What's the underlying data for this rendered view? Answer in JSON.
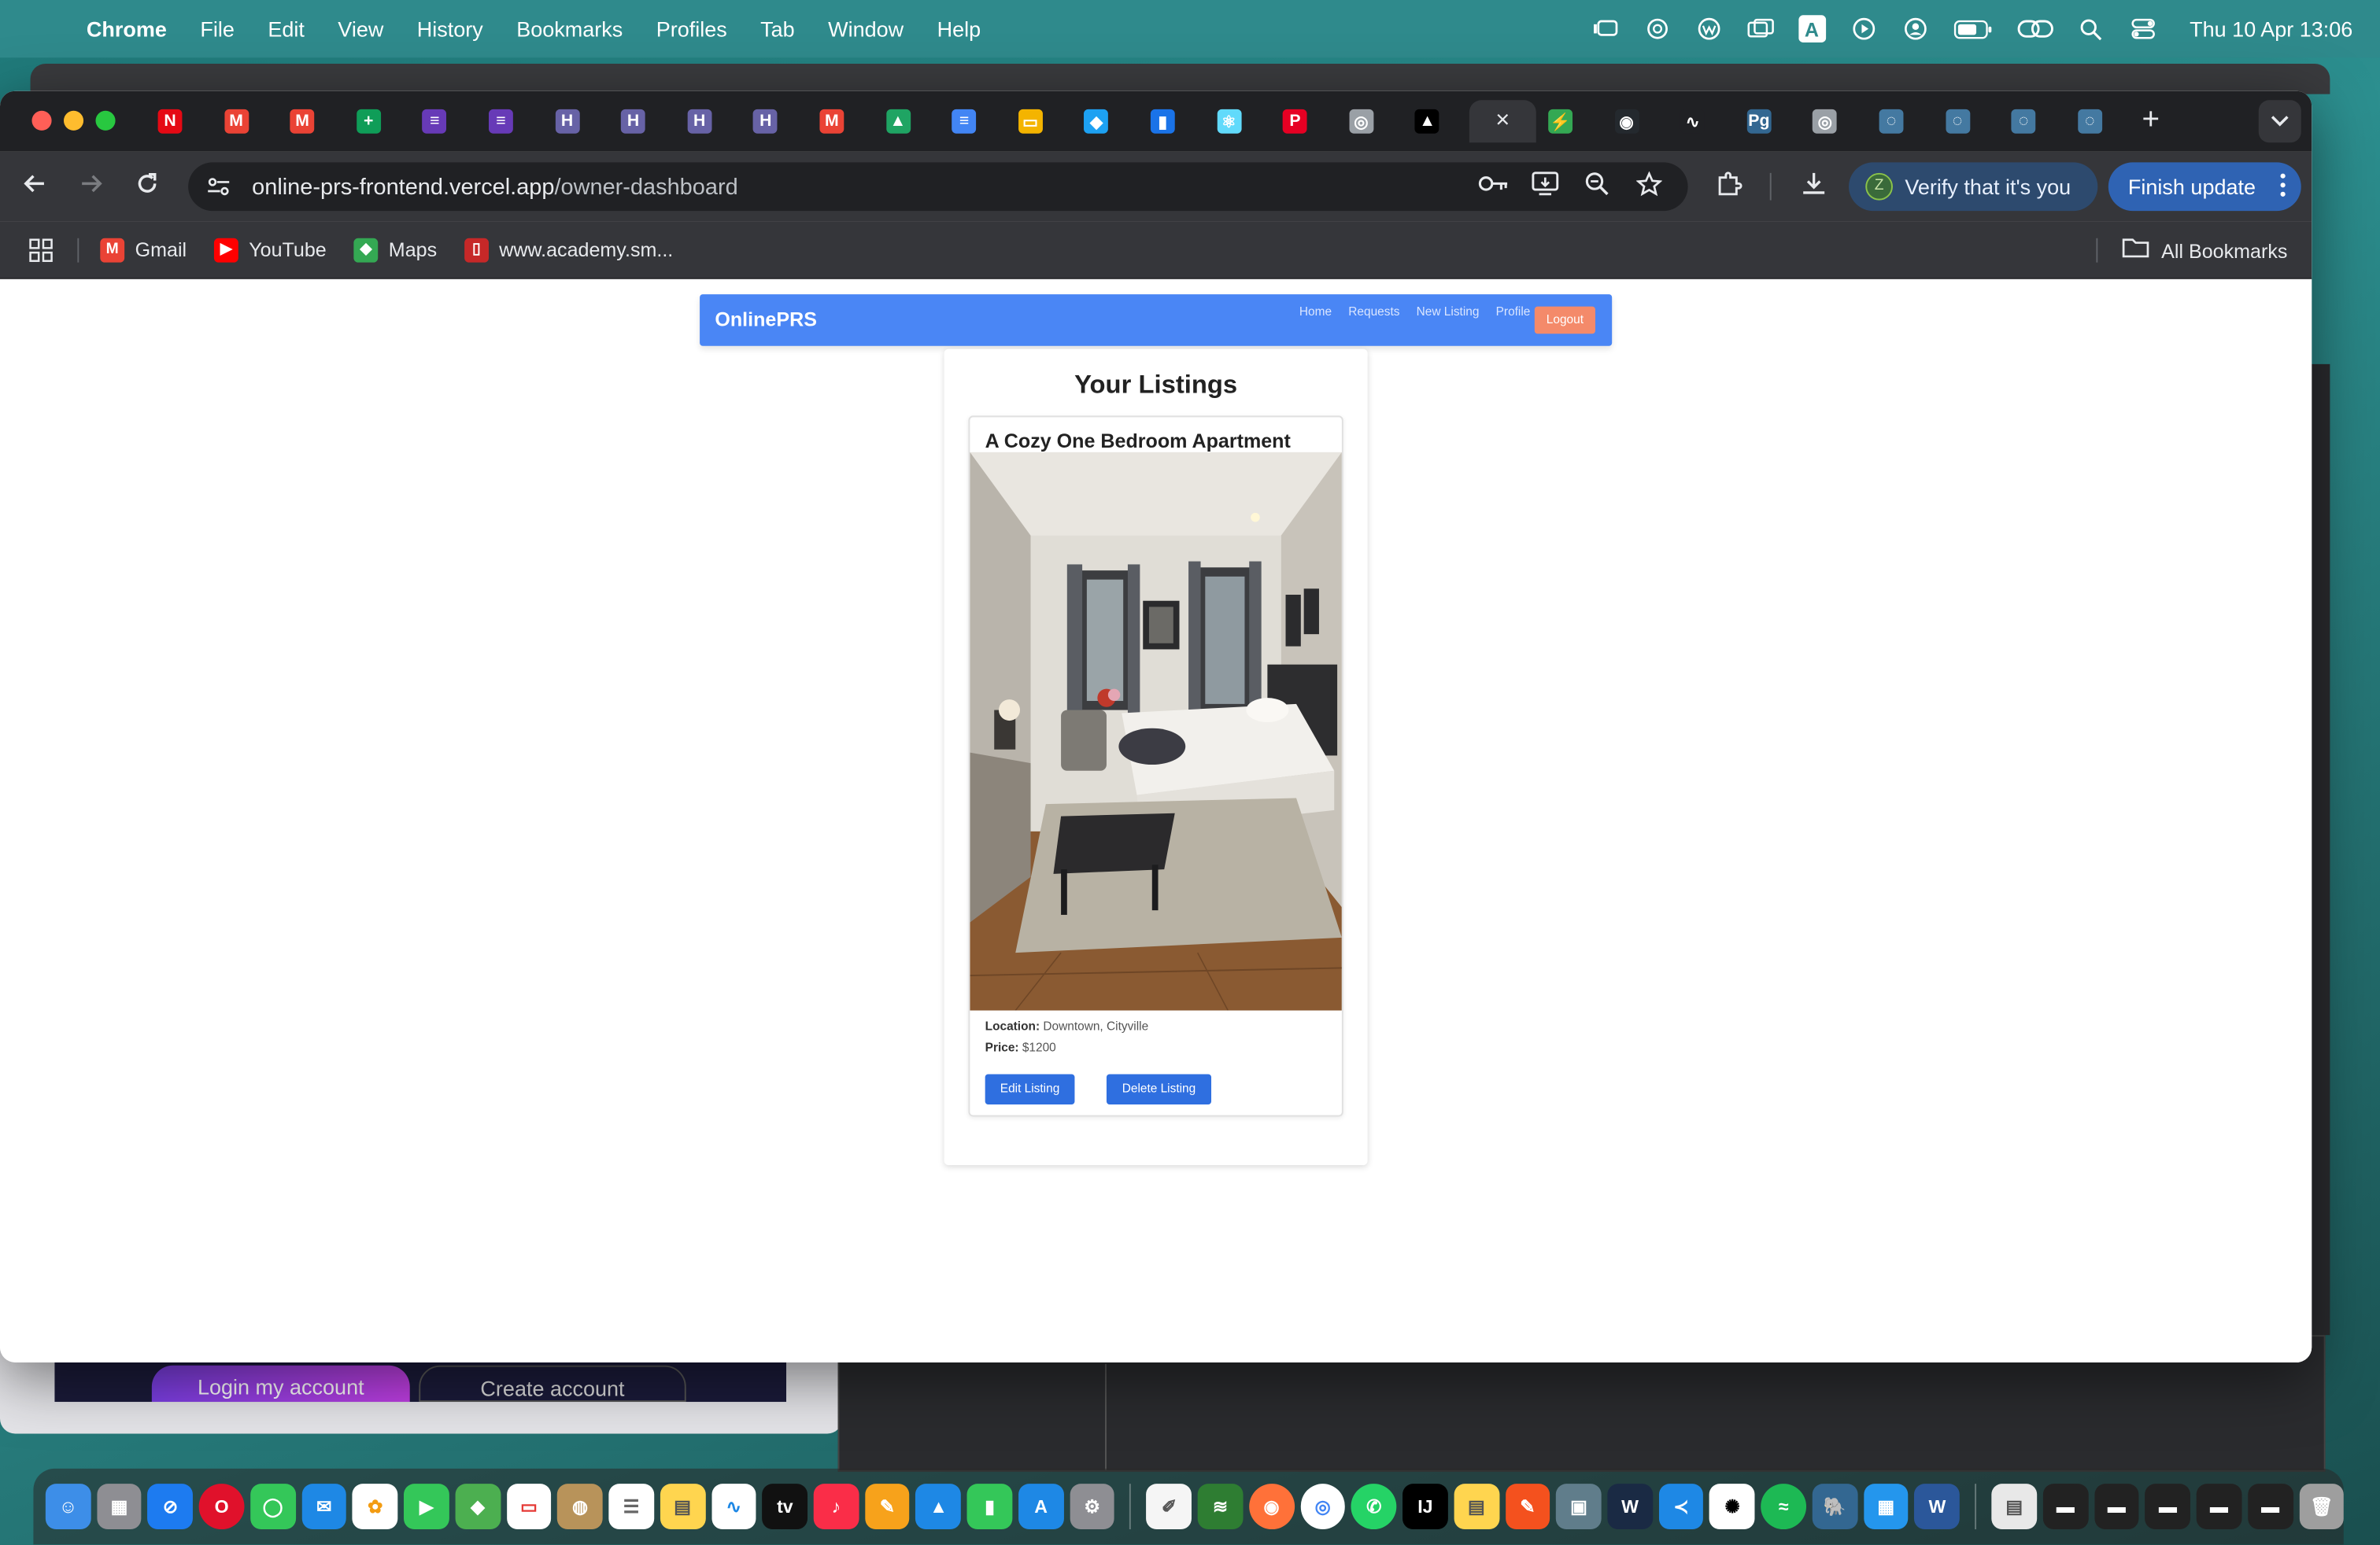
{
  "menubar": {
    "app_name": "Chrome",
    "items": [
      "File",
      "Edit",
      "View",
      "History",
      "Bookmarks",
      "Profiles",
      "Tab",
      "Window",
      "Help"
    ],
    "clock": "Thu 10 Apr  13:06",
    "status_icons": [
      "stage-manager-icon",
      "openai-icon",
      "wacom-icon",
      "screens-icon",
      "input-source-icon",
      "play-icon",
      "user-icon",
      "battery-icon",
      "link-icon",
      "spotlight-icon",
      "control-center-icon"
    ],
    "input_source_label": "A"
  },
  "browser": {
    "tabs": [
      {
        "icon": "netflix-icon",
        "glyph": "N",
        "color": "#e50914"
      },
      {
        "icon": "gmail-icon",
        "glyph": "M",
        "color": "#ea4335"
      },
      {
        "icon": "gmail-icon",
        "glyph": "M",
        "color": "#ea4335"
      },
      {
        "icon": "sheets-plus-icon",
        "glyph": "+",
        "color": "#0f9d58"
      },
      {
        "icon": "forms-icon",
        "glyph": "≡",
        "color": "#673ab7"
      },
      {
        "icon": "forms-icon",
        "glyph": "≡",
        "color": "#673ab7"
      },
      {
        "icon": "heroku-icon",
        "glyph": "H",
        "color": "#6762a6"
      },
      {
        "icon": "heroku-icon",
        "glyph": "H",
        "color": "#6762a6"
      },
      {
        "icon": "heroku-icon",
        "glyph": "H",
        "color": "#6762a6"
      },
      {
        "icon": "heroku-icon",
        "glyph": "H",
        "color": "#6762a6"
      },
      {
        "icon": "gmail-icon",
        "glyph": "M",
        "color": "#ea4335"
      },
      {
        "icon": "drive-icon",
        "glyph": "▲",
        "color": "#1fa463"
      },
      {
        "icon": "docs-icon",
        "glyph": "≡",
        "color": "#4285f4"
      },
      {
        "icon": "slides-icon",
        "glyph": "▭",
        "color": "#f4b400"
      },
      {
        "icon": "app-icon",
        "glyph": "◆",
        "color": "#1da1f2"
      },
      {
        "icon": "chart-icon",
        "glyph": "▮",
        "color": "#1a73e8"
      },
      {
        "icon": "react-icon",
        "glyph": "⚛",
        "color": "#61dafb"
      },
      {
        "icon": "pinterest-icon",
        "glyph": "P",
        "color": "#e60023"
      },
      {
        "icon": "globe-icon",
        "glyph": "◎",
        "color": "#9aa0a6"
      },
      {
        "icon": "vercel-icon",
        "glyph": "▲",
        "color": "#000000"
      },
      {
        "icon": "close-icon",
        "glyph": "×",
        "color": "transparent"
      },
      {
        "icon": "bolt-icon",
        "glyph": "⚡",
        "color": "#34a853"
      },
      {
        "icon": "github-icon",
        "glyph": "◉",
        "color": "#24292e"
      },
      {
        "icon": "render-icon",
        "glyph": "∿",
        "color": "#202124"
      },
      {
        "icon": "pgadmin-icon",
        "glyph": "Pg",
        "color": "#336791"
      },
      {
        "icon": "globe-icon",
        "glyph": "◎",
        "color": "#9aa0a6"
      },
      {
        "icon": "mysql-icon",
        "glyph": "◌",
        "color": "#4479a1"
      },
      {
        "icon": "mysql-icon",
        "glyph": "◌",
        "color": "#4479a1"
      },
      {
        "icon": "mysql-icon",
        "glyph": "◌",
        "color": "#4479a1"
      },
      {
        "icon": "mysql-icon",
        "glyph": "◌",
        "color": "#4479a1"
      }
    ],
    "url_host": "online-prs-frontend.vercel.app",
    "url_path": "/owner-dashboard",
    "verify_label": "Verify that it's you",
    "verify_avatar": "Z",
    "finish_update_label": "Finish update",
    "bookmarks": [
      {
        "label": "Gmail",
        "icon": "gmail-icon",
        "glyph": "M",
        "color": "#ea4335"
      },
      {
        "label": "YouTube",
        "icon": "youtube-icon",
        "glyph": "▶",
        "color": "#ff0000"
      },
      {
        "label": "Maps",
        "icon": "maps-icon",
        "glyph": "◆",
        "color": "#34a853"
      },
      {
        "label": "www.academy.sm...",
        "icon": "academy-icon",
        "glyph": "▯",
        "color": "#c62828"
      }
    ],
    "all_bookmarks_label": "All Bookmarks"
  },
  "app": {
    "brand": "OnlinePRS",
    "nav_links": [
      "Home",
      "Requests",
      "New Listing",
      "Profile"
    ],
    "logout_label": "Logout",
    "page_heading": "Your Listings",
    "listing": {
      "title": "A Cozy One Bedroom Apartment",
      "location_label": "Location:",
      "location_value": "Downtown, Cityville",
      "price_label": "Price:",
      "price_value": "$1200",
      "edit_label": "Edit Listing",
      "delete_label": "Delete Listing"
    }
  },
  "background_window": {
    "login_label": "Login my account",
    "create_label": "Create account"
  }
}
